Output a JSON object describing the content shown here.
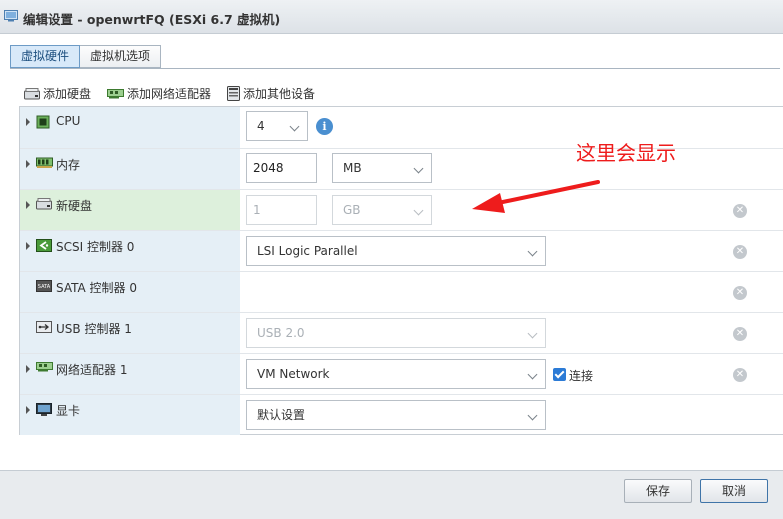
{
  "window": {
    "title": "编辑设置 - openwrtFQ (ESXi 6.7 虚拟机)"
  },
  "tabs": [
    {
      "label": "虚拟硬件",
      "active": true
    },
    {
      "label": "虚拟机选项",
      "active": false
    }
  ],
  "toolbar": {
    "add_disk": "添加硬盘",
    "add_network": "添加网络适配器",
    "add_other": "添加其他设备"
  },
  "devices": [
    {
      "label": "CPU",
      "icon": "cpu-icon",
      "expandable": true,
      "value": "4",
      "info": "i"
    },
    {
      "label": "内存",
      "icon": "memory-icon",
      "expandable": true,
      "value": "2048",
      "unit": "MB"
    },
    {
      "label": "新硬盘",
      "icon": "disk-icon",
      "expandable": true,
      "value": "1",
      "unit": "GB",
      "disabled": true,
      "removable": true
    },
    {
      "label": "SCSI 控制器 0",
      "icon": "scsi-icon",
      "expandable": true,
      "value": "LSI Logic Parallel",
      "removable": true
    },
    {
      "label": "SATA 控制器 0",
      "icon": "sata-icon",
      "expandable": false,
      "removable": true
    },
    {
      "label": "USB 控制器 1",
      "icon": "usb-icon",
      "expandable": false,
      "value": "USB 2.0",
      "disabled": true,
      "removable": true
    },
    {
      "label": "网络适配器 1",
      "icon": "network-card-icon",
      "expandable": true,
      "value": "VM Network",
      "connect_label": "连接",
      "connected": true,
      "removable": true
    },
    {
      "label": "显卡",
      "icon": "display-icon",
      "expandable": true,
      "value": "默认设置"
    }
  ],
  "annotation": {
    "text": "这里会显示",
    "color": "#ee1c1c"
  },
  "footer": {
    "save_label": "保存",
    "cancel_label": "取消"
  },
  "colors": {
    "accent": "#2c7bd6",
    "selected_row": "#ddf0dc",
    "label_cell": "#e5eff6"
  }
}
